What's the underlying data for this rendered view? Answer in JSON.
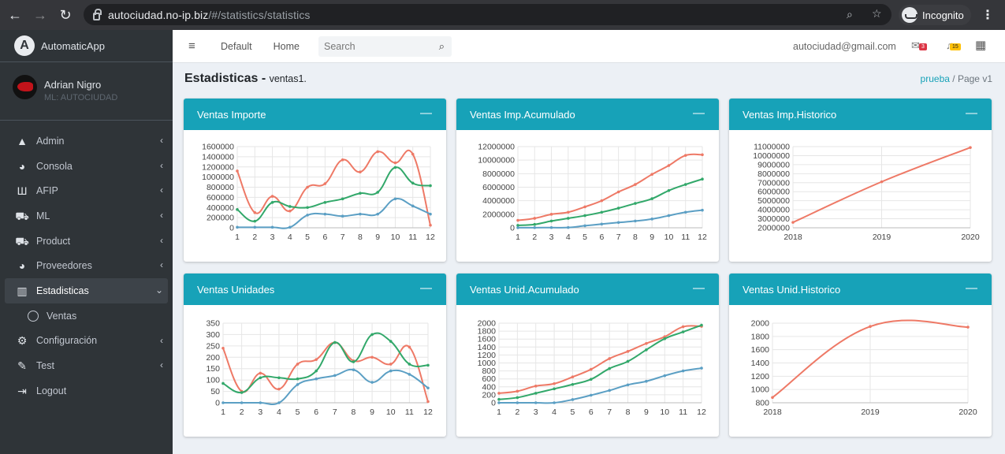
{
  "browser": {
    "url_host": "autociudad.no-ip.biz",
    "url_path": "/#/statistics/statistics",
    "incognito_label": "Incognito"
  },
  "sidebar": {
    "brand": "AutomaticApp",
    "user_name": "Adrian Nigro",
    "user_sub": "ML: AUTOCIUDAD",
    "items": [
      {
        "label": "Admin",
        "icon": "warning-icon"
      },
      {
        "label": "Consola",
        "icon": "dashboard-icon"
      },
      {
        "label": "AFIP",
        "icon": "bank-icon"
      },
      {
        "label": "ML",
        "icon": "cart-icon"
      },
      {
        "label": "Product",
        "icon": "cart-icon"
      },
      {
        "label": "Proveedores",
        "icon": "dashboard-icon"
      },
      {
        "label": "Estadisticas",
        "icon": "bar-chart-icon"
      },
      {
        "label": "Ventas",
        "icon": "circle-icon"
      },
      {
        "label": "Configuración",
        "icon": "gear-icon"
      },
      {
        "label": "Test",
        "icon": "edit-icon"
      },
      {
        "label": "Logout",
        "icon": "logout-icon"
      }
    ]
  },
  "topnav": {
    "default": "Default",
    "home": "Home",
    "search_placeholder": "Search",
    "email": "autociudad@gmail.com",
    "messages_count": "3",
    "notifications_count": "15"
  },
  "page": {
    "title": "Estadisticas -",
    "subtitle": "ventas1.",
    "bc_link": "prueba",
    "bc_sep": "/",
    "bc_current": "Page v1"
  },
  "cards": [
    {
      "title": "Ventas Importe"
    },
    {
      "title": "Ventas Imp.Acumulado"
    },
    {
      "title": "Ventas Imp.Historico"
    },
    {
      "title": "Ventas Unidades"
    },
    {
      "title": "Ventas Unid.Acumulado"
    },
    {
      "title": "Ventas Unid.Historico"
    }
  ],
  "colors": {
    "red": "#ee7966",
    "green": "#32a86a",
    "blue": "#5b9fc4"
  },
  "chart_data": [
    {
      "type": "line",
      "title": "Ventas Importe",
      "x": [
        1,
        2,
        3,
        4,
        5,
        6,
        7,
        8,
        9,
        10,
        11,
        12
      ],
      "ylim": [
        0,
        1600000
      ],
      "yticks": [
        0,
        200000,
        400000,
        600000,
        800000,
        1000000,
        1200000,
        1400000,
        1600000
      ],
      "series": [
        {
          "color": "#ee7966",
          "values": [
            1120000,
            300000,
            620000,
            330000,
            800000,
            870000,
            1340000,
            1100000,
            1500000,
            1280000,
            1450000,
            50000
          ]
        },
        {
          "color": "#32a86a",
          "values": [
            360000,
            130000,
            500000,
            420000,
            400000,
            500000,
            570000,
            680000,
            700000,
            1190000,
            880000,
            830000
          ]
        },
        {
          "color": "#5b9fc4",
          "values": [
            10000,
            10000,
            10000,
            10000,
            250000,
            270000,
            230000,
            270000,
            270000,
            570000,
            430000,
            270000
          ]
        }
      ]
    },
    {
      "type": "line",
      "title": "Ventas Imp.Acumulado",
      "x": [
        1,
        2,
        3,
        4,
        5,
        6,
        7,
        8,
        9,
        10,
        11,
        12
      ],
      "ylim": [
        0,
        12000000
      ],
      "yticks": [
        0,
        2000000,
        4000000,
        6000000,
        8000000,
        10000000,
        12000000
      ],
      "series": [
        {
          "color": "#ee7966",
          "values": [
            1100000,
            1400000,
            2000000,
            2300000,
            3100000,
            4000000,
            5300000,
            6400000,
            7900000,
            9200000,
            10700000,
            10800000
          ]
        },
        {
          "color": "#32a86a",
          "values": [
            360000,
            500000,
            1000000,
            1400000,
            1800000,
            2300000,
            2900000,
            3600000,
            4300000,
            5500000,
            6400000,
            7200000
          ]
        },
        {
          "color": "#5b9fc4",
          "values": [
            10000,
            20000,
            30000,
            40000,
            300000,
            550000,
            780000,
            1000000,
            1300000,
            1800000,
            2300000,
            2600000
          ]
        }
      ]
    },
    {
      "type": "line",
      "title": "Ventas Imp.Historico",
      "x": [
        "2018",
        "2019",
        "2020"
      ],
      "ylim": [
        2000000,
        11000000
      ],
      "yticks": [
        2000000,
        3000000,
        4000000,
        5000000,
        6000000,
        7000000,
        8000000,
        9000000,
        10000000,
        11000000
      ],
      "series": [
        {
          "color": "#ee7966",
          "values": [
            2600000,
            7100000,
            10900000
          ]
        }
      ]
    },
    {
      "type": "line",
      "title": "Ventas Unidades",
      "x": [
        1,
        2,
        3,
        4,
        5,
        6,
        7,
        8,
        9,
        10,
        11,
        12
      ],
      "ylim": [
        0,
        350
      ],
      "yticks": [
        0,
        50,
        100,
        150,
        200,
        250,
        300,
        350
      ],
      "series": [
        {
          "color": "#ee7966",
          "values": [
            240,
            50,
            130,
            60,
            170,
            190,
            265,
            185,
            200,
            170,
            245,
            5
          ]
        },
        {
          "color": "#32a86a",
          "values": [
            85,
            45,
            110,
            110,
            105,
            140,
            265,
            180,
            300,
            270,
            170,
            165
          ]
        },
        {
          "color": "#5b9fc4",
          "values": [
            0,
            0,
            0,
            0,
            80,
            105,
            120,
            145,
            90,
            140,
            125,
            65
          ]
        }
      ]
    },
    {
      "type": "line",
      "title": "Ventas Unid.Acumulado",
      "x": [
        1,
        2,
        3,
        4,
        5,
        6,
        7,
        8,
        9,
        10,
        11,
        12
      ],
      "ylim": [
        0,
        2000
      ],
      "yticks": [
        0,
        200,
        400,
        600,
        800,
        1000,
        1200,
        1400,
        1600,
        1800,
        2000
      ],
      "series": [
        {
          "color": "#ee7966",
          "values": [
            240,
            290,
            420,
            480,
            650,
            840,
            1110,
            1290,
            1490,
            1660,
            1910,
            1920
          ]
        },
        {
          "color": "#32a86a",
          "values": [
            85,
            130,
            240,
            350,
            460,
            590,
            860,
            1040,
            1330,
            1610,
            1780,
            1950
          ]
        },
        {
          "color": "#5b9fc4",
          "values": [
            0,
            0,
            0,
            0,
            80,
            190,
            310,
            450,
            540,
            680,
            800,
            870
          ]
        }
      ]
    },
    {
      "type": "line",
      "title": "Ventas Unid.Historico",
      "x": [
        "2018",
        "2019",
        "2020"
      ],
      "ylim": [
        800,
        2000
      ],
      "yticks": [
        800,
        1000,
        1200,
        1400,
        1600,
        1800,
        2000
      ],
      "series": [
        {
          "color": "#ee7966",
          "values": [
            880,
            1950,
            1940
          ]
        }
      ]
    }
  ]
}
